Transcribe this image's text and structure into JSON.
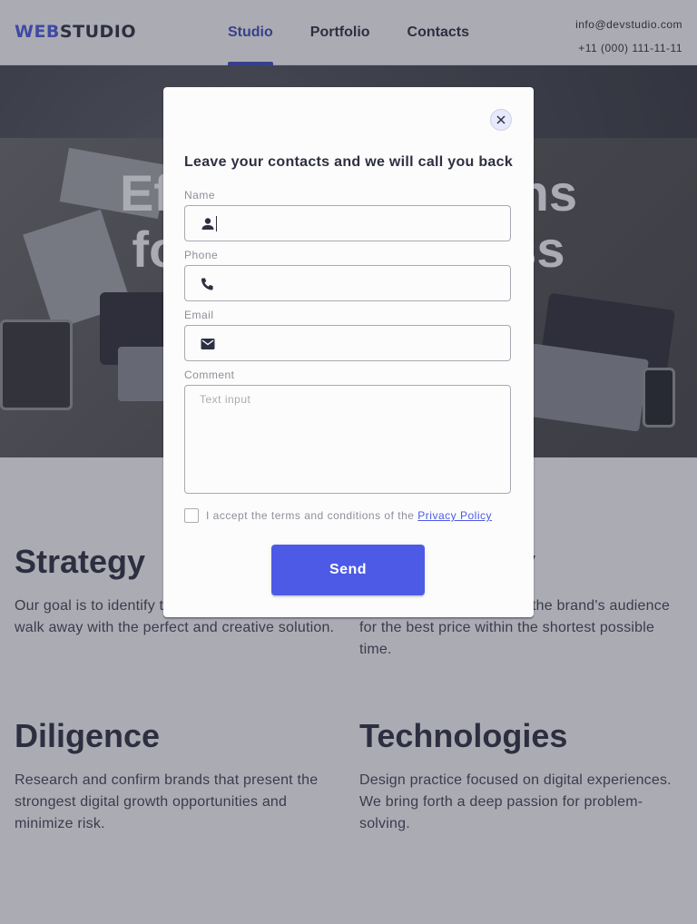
{
  "header": {
    "logo_part1": "WEB",
    "logo_part2": "STUDIO",
    "nav": [
      {
        "label": "Studio",
        "active": true
      },
      {
        "label": "Portfolio",
        "active": false
      },
      {
        "label": "Contacts",
        "active": false
      }
    ],
    "email": "info@devstudio.com",
    "phone": "+11 (000) 111-11-11"
  },
  "hero": {
    "title_line1": "Effective Solutions",
    "title_line2": "for Your Business"
  },
  "features": [
    {
      "title": "Strategy",
      "text": "Our goal is to identify the business problem to walk away with the perfect and creative solution."
    },
    {
      "title": "Punctuality",
      "text": "Bring the key message to the brand's audience for the best price within the shortest possible time."
    },
    {
      "title": "Diligence",
      "text": "Research and confirm brands that present the strongest digital growth opportunities and minimize risk."
    },
    {
      "title": "Technologies",
      "text": "Design practice focused on digital experiences. We bring forth a deep passion for problem-solving."
    }
  ],
  "modal": {
    "title": "Leave your contacts and we will call you back",
    "name_label": "Name",
    "name_value": "",
    "phone_label": "Phone",
    "phone_value": "",
    "email_label": "Email",
    "email_value": "",
    "comment_label": "Comment",
    "comment_placeholder": "Text input",
    "accept_text": "I accept the terms and conditions of the ",
    "privacy_link": "Privacy Policy",
    "send_label": "Send",
    "icons": [
      "close-icon",
      "person-icon",
      "phone-icon",
      "mail-icon"
    ]
  },
  "colors": {
    "accent": "#4d5ae5",
    "nav_active": "#404bbf",
    "text_dark": "#2e2f42",
    "backdrop": "rgba(46,47,66,0.4)"
  }
}
